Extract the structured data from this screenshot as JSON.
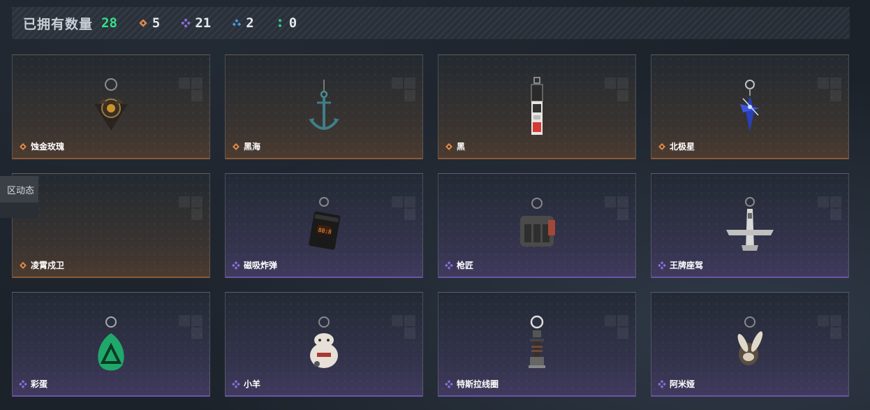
{
  "header": {
    "title": "已拥有数量",
    "total": "28",
    "stats": [
      {
        "icon": "orange-diamond-icon",
        "color": "#e08a4a",
        "value": "5"
      },
      {
        "icon": "purple-diamond-icon",
        "color": "#8b6fe0",
        "value": "21"
      },
      {
        "icon": "blue-diamond-icon",
        "color": "#4a9be0",
        "value": "2"
      },
      {
        "icon": "green-diamond-icon",
        "color": "#35c98a",
        "value": "0"
      }
    ]
  },
  "side_tab": {
    "label": "区动态"
  },
  "items": [
    {
      "name": "蚀金玫瑰",
      "rarity": "orange",
      "icon": "rose-charm-icon"
    },
    {
      "name": "黑海",
      "rarity": "orange",
      "icon": "anchor-charm-icon"
    },
    {
      "name": "黑",
      "rarity": "orange",
      "icon": "tag-charm-icon"
    },
    {
      "name": "北极星",
      "rarity": "orange",
      "icon": "star-charm-icon"
    },
    {
      "name": "凌霄戍卫",
      "rarity": "orange",
      "icon": "empty-charm-icon"
    },
    {
      "name": "磁吸炸弹",
      "rarity": "purple",
      "icon": "bomb-charm-icon"
    },
    {
      "name": "枪匠",
      "rarity": "purple",
      "icon": "vest-charm-icon"
    },
    {
      "name": "王牌座驾",
      "rarity": "purple",
      "icon": "jet-charm-icon"
    },
    {
      "name": "彩蛋",
      "rarity": "purple",
      "icon": "egg-charm-icon"
    },
    {
      "name": "小羊",
      "rarity": "purple",
      "icon": "lamb-charm-icon"
    },
    {
      "name": "特斯拉线圈",
      "rarity": "purple",
      "icon": "coil-charm-icon"
    },
    {
      "name": "阿米娅",
      "rarity": "purple",
      "icon": "bunny-charm-icon"
    }
  ],
  "colors": {
    "orange": "#e08a4a",
    "purple": "#8b6fe0",
    "accent_green": "#35e08a"
  }
}
